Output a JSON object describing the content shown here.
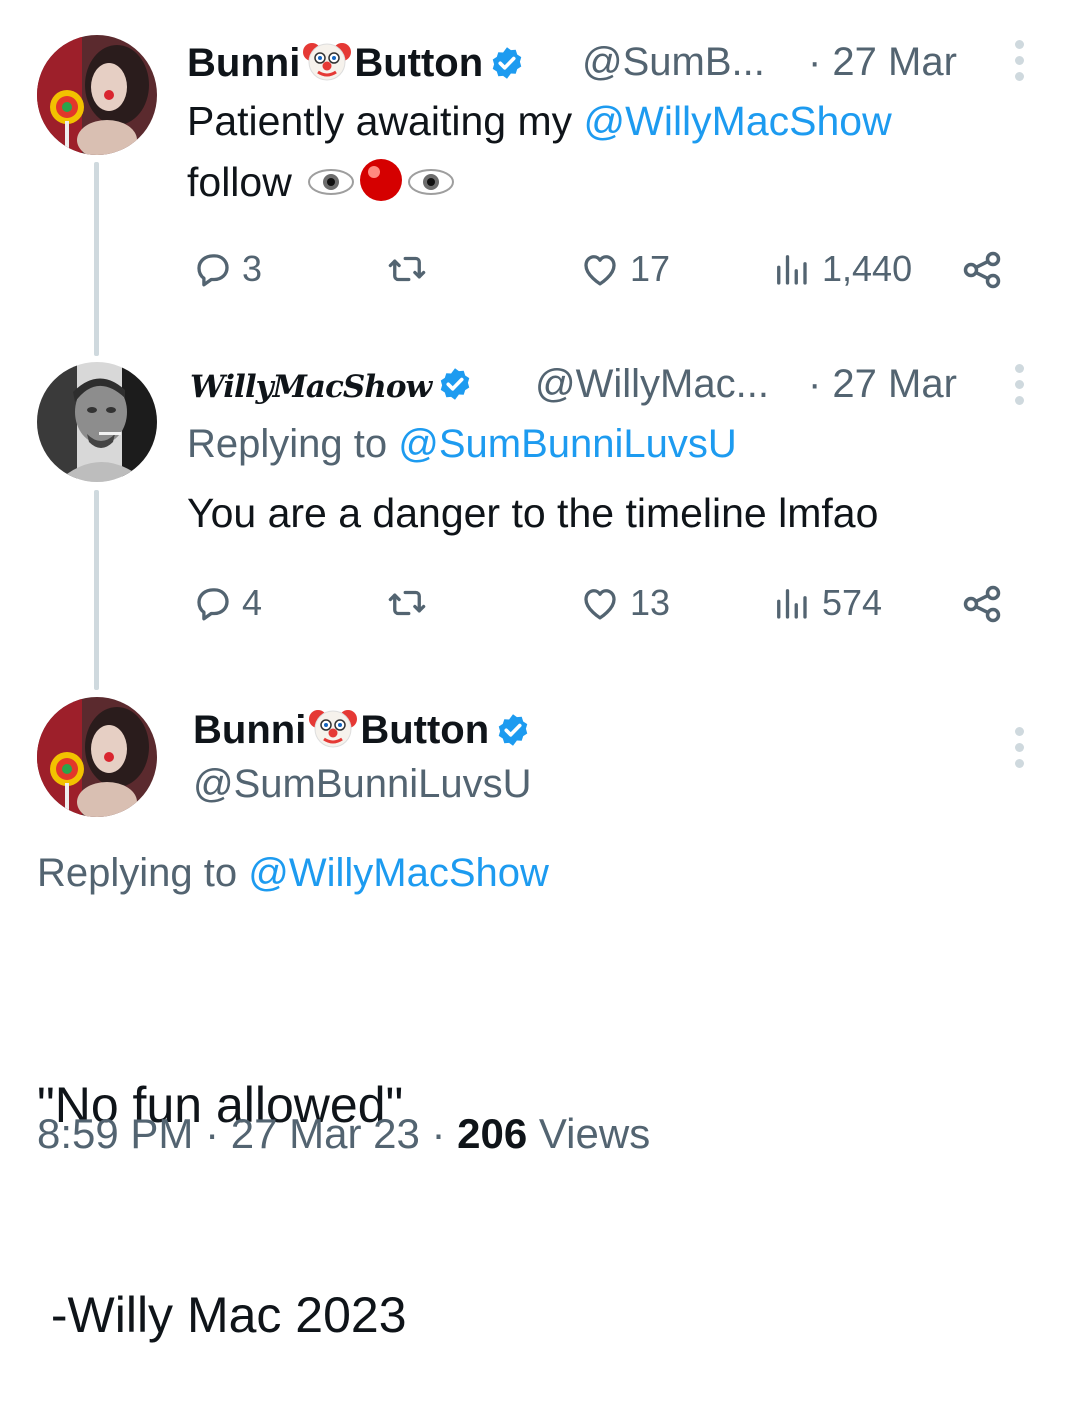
{
  "tweets": [
    {
      "name_before": "Bunni",
      "name_after": "Button",
      "handle": "@SumB...",
      "date": "· 27 Mar",
      "text_line1_prefix": "Patiently awaiting my ",
      "text_line1_mention": "@WillyMacShow",
      "text_line2": "follow",
      "emoji": "👁️🔴👁️",
      "replies": "3",
      "likes": "17",
      "views": "1,440"
    },
    {
      "name": "WillyMacShow",
      "handle": "@WillyMac...",
      "date": "· 27 Mar",
      "replying_prefix": "Replying to ",
      "replying_to": "@SumBunniLuvsU",
      "text": "You are a danger to the timeline lmfao",
      "replies": "4",
      "likes": "13",
      "views": "574"
    }
  ],
  "main_tweet": {
    "name_before": "Bunni",
    "name_after": "Button",
    "handle": "@SumBunniLuvsU",
    "replying_prefix": "Replying to ",
    "replying_to": "@WillyMacShow",
    "text_line1": "\"No fun allowed\"",
    "text_line2": " -Willy Mac 2023",
    "time": "8:59 PM · 27 Mar 23 · ",
    "views_count": "206",
    "views_label": " Views"
  },
  "colors": {
    "link": "#1d9bf0",
    "muted": "#536471",
    "thread_line": "#cfd9de",
    "verified": "#1d9bf0"
  },
  "icons": [
    "reply-icon",
    "retweet-icon",
    "like-icon",
    "views-icon",
    "share-icon",
    "more-icon",
    "verified-badge-icon",
    "clown-emoji-icon"
  ]
}
